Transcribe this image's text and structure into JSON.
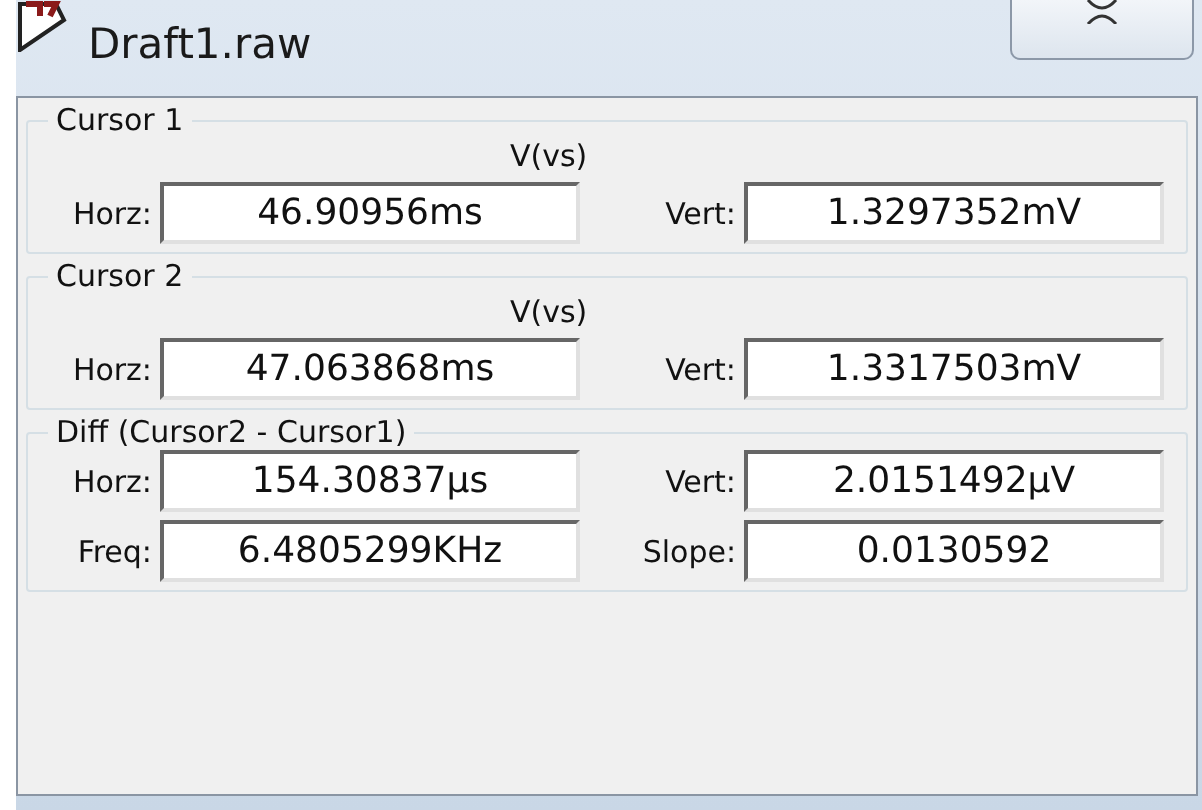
{
  "window": {
    "title": "Draft1.raw"
  },
  "groups": [
    {
      "title": "Cursor 1",
      "trace": "V(vs)",
      "rows": [
        [
          {
            "label": "Horz:",
            "value": "46.90956ms"
          },
          {
            "label": "Vert:",
            "value": "1.3297352mV"
          }
        ]
      ]
    },
    {
      "title": "Cursor 2",
      "trace": "V(vs)",
      "rows": [
        [
          {
            "label": "Horz:",
            "value": "47.063868ms"
          },
          {
            "label": "Vert:",
            "value": "1.3317503mV"
          }
        ]
      ]
    },
    {
      "title": "Diff (Cursor2 - Cursor1)",
      "rows": [
        [
          {
            "label": "Horz:",
            "value": "154.30837µs"
          },
          {
            "label": "Vert:",
            "value": "2.0151492µV"
          }
        ],
        [
          {
            "label": "Freq:",
            "value": "6.4805299KHz"
          },
          {
            "label": "Slope:",
            "value": "0.0130592"
          }
        ]
      ]
    }
  ]
}
